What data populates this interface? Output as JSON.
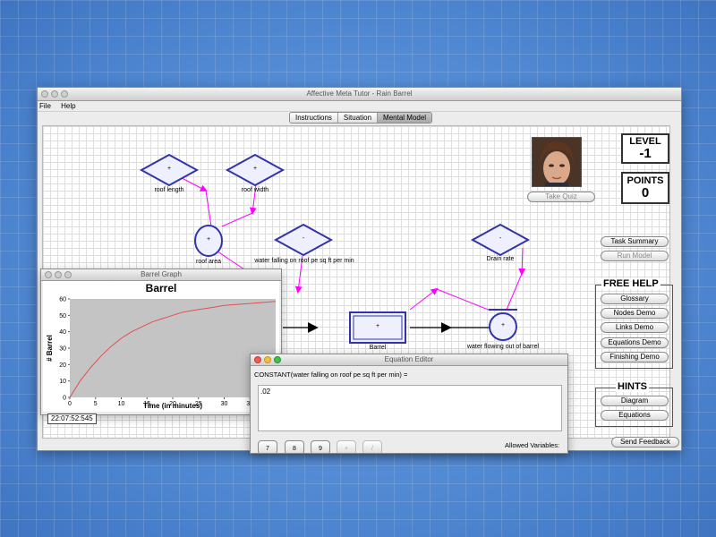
{
  "window": {
    "title": "Affective Meta Tutor - Rain Barrel"
  },
  "menu": {
    "file": "File",
    "help": "Help"
  },
  "tabs": {
    "instructions": "Instructions",
    "situation": "Situation",
    "mental_model": "Mental Model"
  },
  "nodes": {
    "roof_length": {
      "symbol": "+",
      "label": "roof length"
    },
    "roof_width": {
      "symbol": "+",
      "label": "roof width"
    },
    "roof_area": {
      "symbol": "+",
      "label": "roof area"
    },
    "water_falling": {
      "symbol": "-",
      "label": "water falling on roof pe sq ft per min"
    },
    "drain_rate": {
      "symbol": "-",
      "label": "Drain rate"
    },
    "barrel": {
      "symbol": "+",
      "label": "Barrel"
    },
    "water_flowing_out": {
      "symbol": "+",
      "label": "water flowing out of barrel"
    }
  },
  "avatar": {
    "take_quiz": "Take Quiz"
  },
  "level": {
    "label": "LEVEL",
    "value": "-1"
  },
  "points": {
    "label": "POINTS",
    "value": "0"
  },
  "controls": {
    "task_summary": "Task Summary",
    "run_model": "Run Model"
  },
  "free_help": {
    "title": "FREE HELP",
    "glossary": "Glossary",
    "nodes_demo": "Nodes Demo",
    "links_demo": "Links Demo",
    "equations_demo": "Equations Demo",
    "finishing_demo": "Finishing Demo"
  },
  "hints": {
    "title": "HINTS",
    "diagram": "Diagram",
    "equations": "Equations"
  },
  "send_feedback": "Send Feedback",
  "graph_window": {
    "title": "Barrel Graph"
  },
  "chart_data": {
    "type": "line",
    "title": "Barrel",
    "xlabel": "Time (in minutes)",
    "ylabel": "# Barrel",
    "xlim": [
      0,
      40
    ],
    "ylim": [
      0,
      60
    ],
    "xticks": [
      0,
      5,
      10,
      15,
      20,
      25,
      30,
      35
    ],
    "yticks": [
      0,
      10,
      20,
      30,
      40,
      50,
      60
    ],
    "grid": false,
    "series": [
      {
        "color": "#e05050",
        "x": [
          0,
          2,
          4,
          6,
          8,
          10,
          12,
          14,
          16,
          18,
          20,
          22,
          24,
          26,
          28,
          30,
          32,
          34,
          36,
          38,
          40
        ],
        "y": [
          0,
          10,
          18,
          25,
          31,
          36,
          40,
          43,
          46,
          48,
          50,
          52,
          53,
          54,
          55,
          56,
          56.5,
          57,
          57.5,
          58,
          58.5
        ]
      }
    ]
  },
  "timestamp": "22:07:52:545",
  "editor": {
    "title": "Equation Editor",
    "prompt": "CONSTANT(water falling on roof pe sq ft per min) =",
    "value": ".02",
    "allowed_variables": "Allowed Variables:",
    "keys": [
      "7",
      "8",
      "9",
      "+",
      "/"
    ]
  },
  "colors": {
    "link_magenta": "#ff00ff",
    "node_border": "#3333aa",
    "node_fill": "#e8e8ff"
  }
}
